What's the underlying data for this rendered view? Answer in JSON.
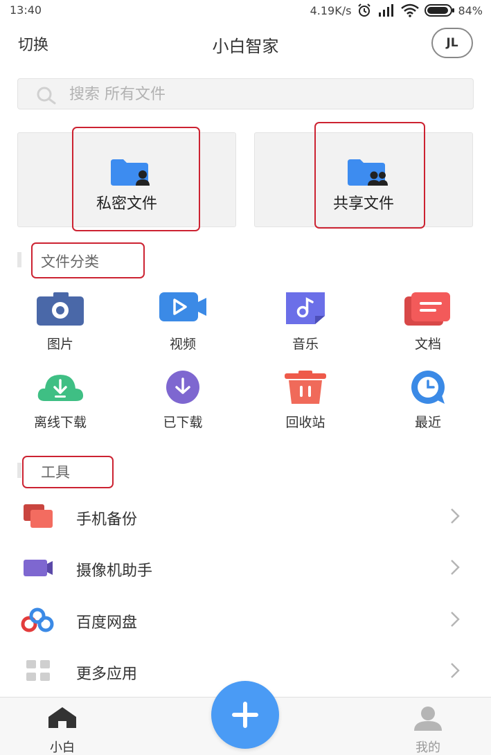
{
  "status_bar": {
    "time": "13:40",
    "speed": "4.19K/s",
    "battery": "84%"
  },
  "header": {
    "switch_label": "切换",
    "title": "小白智家",
    "avatar_text": "JL"
  },
  "search": {
    "placeholder": "搜索 所有文件"
  },
  "cards": {
    "private_label": "私密文件",
    "shared_label": "共享文件"
  },
  "categories": {
    "title": "文件分类",
    "items": [
      {
        "label": "图片",
        "icon": "camera-icon"
      },
      {
        "label": "视频",
        "icon": "video-icon"
      },
      {
        "label": "音乐",
        "icon": "music-icon"
      },
      {
        "label": "文档",
        "icon": "document-icon"
      },
      {
        "label": "离线下载",
        "icon": "cloud-download-icon"
      },
      {
        "label": "已下载",
        "icon": "downloaded-icon"
      },
      {
        "label": "回收站",
        "icon": "trash-icon"
      },
      {
        "label": "最近",
        "icon": "clock-icon"
      }
    ]
  },
  "tools": {
    "title": "工具",
    "items": [
      {
        "label": "手机备份",
        "icon": "phone-backup-icon"
      },
      {
        "label": "摄像机助手",
        "icon": "camera-assistant-icon"
      },
      {
        "label": "百度网盘",
        "icon": "baidu-pan-icon"
      },
      {
        "label": "更多应用",
        "icon": "more-apps-icon"
      }
    ]
  },
  "bottom_nav": {
    "home_label": "小白",
    "mine_label": "我的"
  },
  "colors": {
    "accent": "#4a9bf5",
    "highlight_border": "#cc2231",
    "folder_blue": "#3d8cf0"
  }
}
